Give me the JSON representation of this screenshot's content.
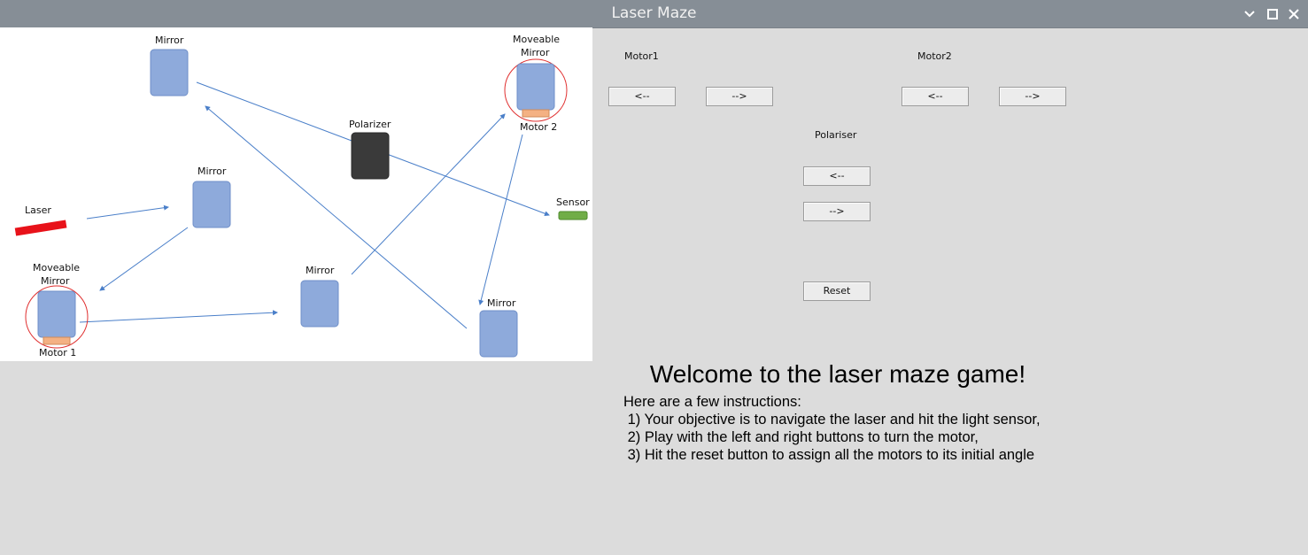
{
  "window": {
    "title": "Laser Maze",
    "controls": [
      "minimize-icon",
      "maximize-icon",
      "close-icon"
    ]
  },
  "diagram": {
    "labels": {
      "mirror_top_left": "Mirror",
      "moveable_mirror_2": [
        "Moveable",
        "Mirror"
      ],
      "motor_2": "Motor 2",
      "polarizer": "Polarizer",
      "mirror_mid_left": "Mirror",
      "laser": "Laser",
      "sensor": "Sensor",
      "moveable_mirror_1": [
        "Moveable",
        "Mirror"
      ],
      "motor_1": "Motor 1",
      "mirror_bottom_center": "Mirror",
      "mirror_bottom_right": "Mirror"
    },
    "colors": {
      "mirror": "#8eaadb",
      "polarizer": "#3a3a3a",
      "laser": "#e8121a",
      "sensor": "#70ad47",
      "motor": "#f4b183",
      "beam": "#4a7fc9",
      "motor_ring": "#e03030"
    }
  },
  "controls": {
    "motor1": {
      "label": "Motor1",
      "left_button": "<--",
      "right_button": "-->"
    },
    "motor2": {
      "label": "Motor2",
      "left_button": "<--",
      "right_button": "-->"
    },
    "polariser": {
      "label": "Polariser",
      "left_button": "<--",
      "right_button": "-->"
    },
    "reset_button": "Reset"
  },
  "instructions": {
    "heading": "Welcome to the laser maze game!",
    "intro": "Here are a few instructions:",
    "lines": [
      " 1) Your objective is to navigate the laser and hit the light sensor,",
      " 2) Play with the left and right buttons to turn the motor,",
      " 3) Hit the reset button to assign all the motors to its initial angle"
    ]
  }
}
